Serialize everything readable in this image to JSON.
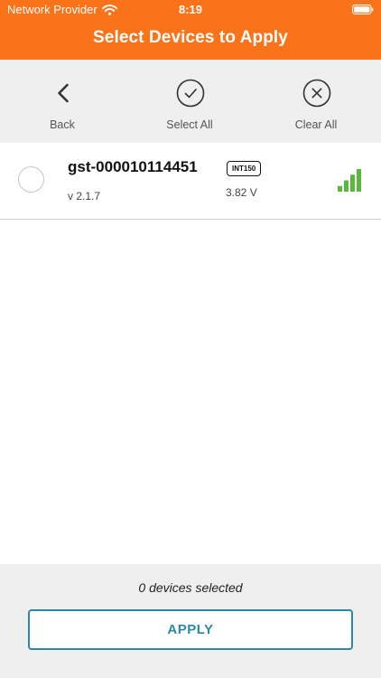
{
  "status_bar": {
    "carrier": "Network Provider",
    "time": "8:19",
    "icons": [
      "wifi-icon",
      "battery-icon"
    ]
  },
  "nav": {
    "title": "Select Devices to Apply"
  },
  "toolbar": {
    "back_label": "Back",
    "back_icon": "chevron-left-icon",
    "select_all_label": "Select All",
    "select_all_icon": "check-circle-icon",
    "clear_all_label": "Clear All",
    "clear_all_icon": "x-circle-icon"
  },
  "devices": [
    {
      "name": "gst-000010114451",
      "model": "INT150",
      "version": "v 2.1.7",
      "voltage": "3.82 V",
      "selected": false,
      "signal_bars": 4,
      "signal_icon": "signal-strength-icon"
    }
  ],
  "footer": {
    "selection_count": "0 devices selected",
    "apply_label": "APPLY"
  },
  "colors": {
    "header": "#fb7319",
    "toolbar_bg": "#efefef",
    "signal_green": "#5cb83c",
    "apply_accent": "#2d89a3"
  }
}
